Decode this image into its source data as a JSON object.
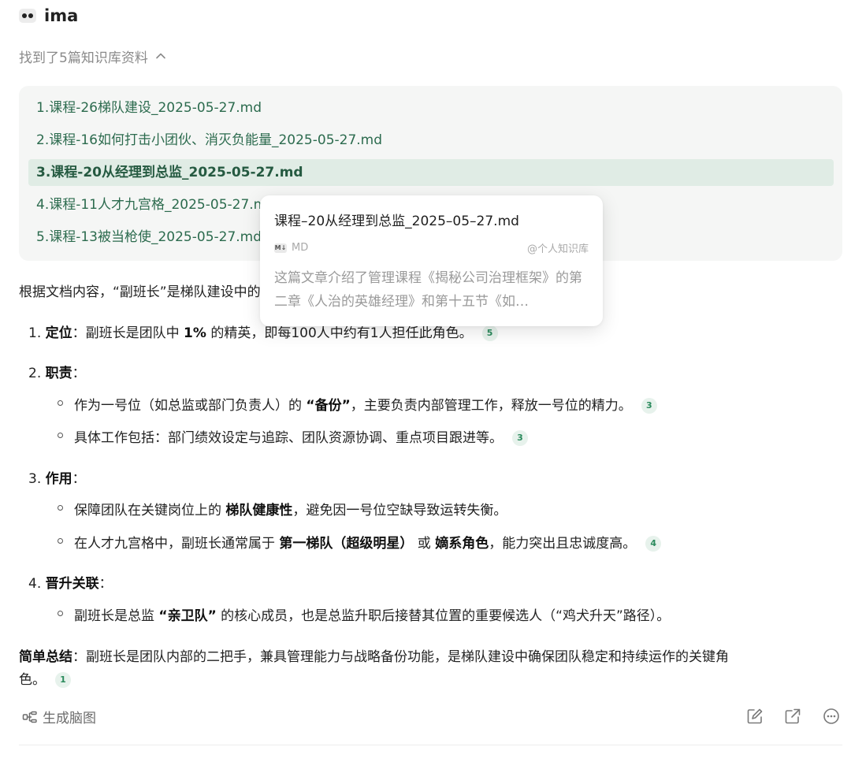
{
  "app": {
    "name": "ima"
  },
  "sources": {
    "summary": "找到了5篇知识库资料",
    "items": [
      {
        "label": "1.课程-26梯队建设_2025-05-27.md"
      },
      {
        "label": "2.课程-16如何打击小团伙、消灭负能量_2025-05-27.md"
      },
      {
        "label": "3.课程-20从经理到总监_2025-05-27.md"
      },
      {
        "label": "4.课程-11人才九宫格_2025-05-27.md"
      },
      {
        "label": "5.课程-13被当枪使_2025-05-27.md"
      }
    ]
  },
  "popup": {
    "title": "课程–20从经理到总监_2025–05–27.md",
    "type": "MD",
    "source": "@个人知识库",
    "desc": "这篇文章介绍了管理课程《揭秘公司治理框架》的第二章《人治的英雄经理》和第十五节《如…"
  },
  "answer": {
    "intro": "根据文档内容，“副班长”是梯队建设中的关键角色，具体定义如下：",
    "s1": {
      "num": "1.",
      "title": "定位",
      "sep": "：",
      "t1": "副班长是团队中 ",
      "b1": "1%",
      "t2": " 的精英，即每100人中约有1人担任此角色。",
      "cite": "5"
    },
    "s2": {
      "num": "2.",
      "title": "职责",
      "sep": "：",
      "b1_t1": "作为一号位（如总监或部门负责人）的 ",
      "b1_b": "“备份”",
      "b1_t2": "，主要负责内部管理工作，释放一号位的精力。",
      "b1_cite": "3",
      "b2_t1": "具体工作包括：部门绩效设定与追踪、团队资源协调、重点项目跟进等。",
      "b2_cite": "3"
    },
    "s3": {
      "num": "3.",
      "title": "作用",
      "sep": "：",
      "b1_t1": "保障团队在关键岗位上的 ",
      "b1_b": "梯队健康性",
      "b1_t2": "，避免因一号位空缺导致运转失衡。",
      "b2_t1": "在人才九宫格中，副班长通常属于 ",
      "b2_b1": "第一梯队（超级明星）",
      "b2_t2": " 或 ",
      "b2_b2": "嫡系角色",
      "b2_t3": "，能力突出且忠诚度高。",
      "b2_cite": "4"
    },
    "s4": {
      "num": "4.",
      "title": "晋升关联",
      "sep": "：",
      "b1_t1": "副班长是总监 ",
      "b1_b": "“亲卫队”",
      "b1_t2": " 的核心成员，也是总监升职后接替其位置的重要候选人（“鸡犬升天”路径）。"
    },
    "summary": {
      "label": "简单总结",
      "sep": "：",
      "line1": "副班长是团队内部的二把手，兼具管理能力与战略备份功能，是梯队建设中确保团队稳定和持续运作的关键角",
      "line2": "色。",
      "cite": "1"
    }
  },
  "footer": {
    "mindmap": "生成脑图"
  },
  "colors": {
    "accent_green": "#2c6b4e",
    "cite_bg": "#e7f2ec",
    "cite_fg": "#2a8a5c"
  }
}
